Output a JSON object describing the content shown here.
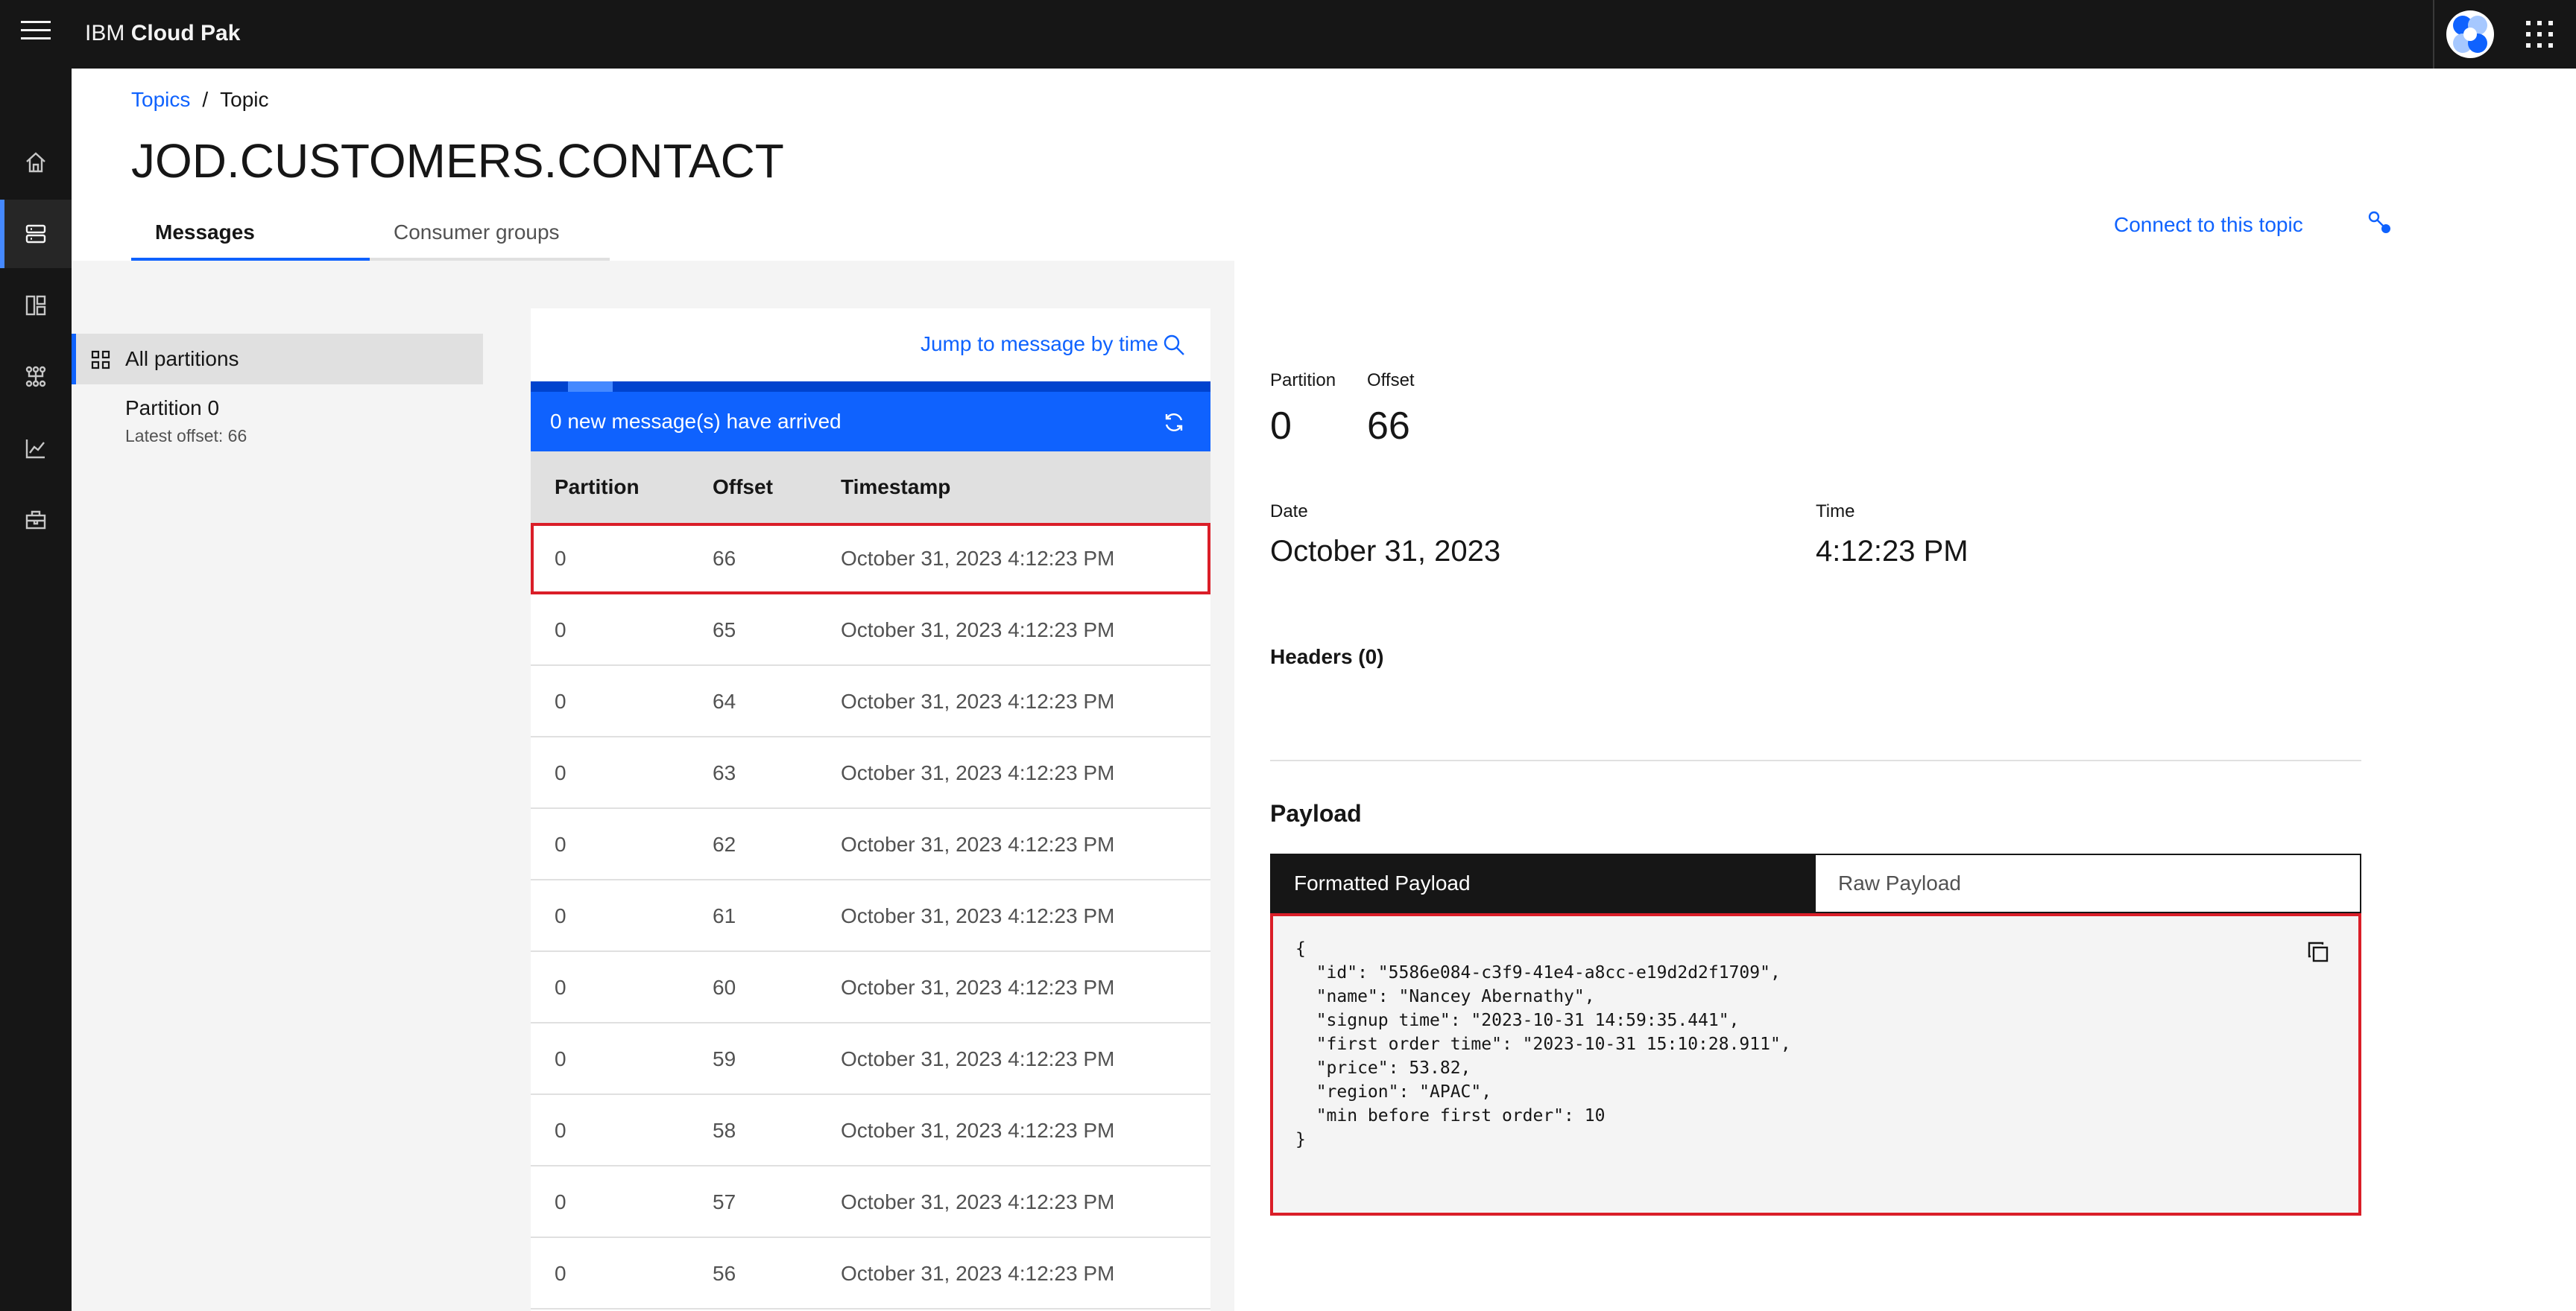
{
  "header": {
    "brand_prefix": "IBM",
    "brand_name": "Cloud Pak"
  },
  "rail": {
    "items": [
      "home-icon",
      "topics-icon",
      "schemas-icon",
      "consumer-groups-icon",
      "monitoring-icon",
      "toolbox-icon"
    ],
    "active_index": 1
  },
  "breadcrumb": {
    "parent": "Topics",
    "separator": "/",
    "current": "Topic"
  },
  "page_title": "JOD.CUSTOMERS.CONTACT",
  "tabs": {
    "messages": "Messages",
    "consumer_groups": "Consumer groups"
  },
  "connect_link": "Connect to this topic",
  "partitions": {
    "all_label": "All partitions",
    "items": [
      {
        "name": "Partition 0",
        "latest": "Latest offset: 66"
      }
    ]
  },
  "messages": {
    "jump_link": "Jump to message by time",
    "new_banner": "0 new message(s) have arrived",
    "columns": [
      "Partition",
      "Offset",
      "Timestamp"
    ],
    "rows": [
      {
        "partition": "0",
        "offset": "66",
        "timestamp": "October 31, 2023 4:12:23 PM"
      },
      {
        "partition": "0",
        "offset": "65",
        "timestamp": "October 31, 2023 4:12:23 PM"
      },
      {
        "partition": "0",
        "offset": "64",
        "timestamp": "October 31, 2023 4:12:23 PM"
      },
      {
        "partition": "0",
        "offset": "63",
        "timestamp": "October 31, 2023 4:12:23 PM"
      },
      {
        "partition": "0",
        "offset": "62",
        "timestamp": "October 31, 2023 4:12:23 PM"
      },
      {
        "partition": "0",
        "offset": "61",
        "timestamp": "October 31, 2023 4:12:23 PM"
      },
      {
        "partition": "0",
        "offset": "60",
        "timestamp": "October 31, 2023 4:12:23 PM"
      },
      {
        "partition": "0",
        "offset": "59",
        "timestamp": "October 31, 2023 4:12:23 PM"
      },
      {
        "partition": "0",
        "offset": "58",
        "timestamp": "October 31, 2023 4:12:23 PM"
      },
      {
        "partition": "0",
        "offset": "57",
        "timestamp": "October 31, 2023 4:12:23 PM"
      },
      {
        "partition": "0",
        "offset": "56",
        "timestamp": "October 31, 2023 4:12:23 PM"
      }
    ]
  },
  "detail": {
    "partition_label": "Partition",
    "partition_value": "0",
    "offset_label": "Offset",
    "offset_value": "66",
    "date_label": "Date",
    "date_value": "October 31, 2023",
    "time_label": "Time",
    "time_value": "4:12:23 PM",
    "headers_title": "Headers (0)",
    "payload_title": "Payload",
    "payload_tab_formatted": "Formatted Payload",
    "payload_tab_raw": "Raw Payload",
    "payload_text": "{\n  \"id\": \"5586e084-c3f9-41e4-a8cc-e19d2d2f1709\",\n  \"name\": \"Nancey Abernathy\",\n  \"signup time\": \"2023-10-31 14:59:35.441\",\n  \"first order time\": \"2023-10-31 15:10:28.911\",\n  \"price\": 53.82,\n  \"region\": \"APAC\",\n  \"min before first order\": 10\n}"
  },
  "colors": {
    "accent": "#0f62fe",
    "highlight": "#da1e28",
    "shell": "#161616"
  }
}
